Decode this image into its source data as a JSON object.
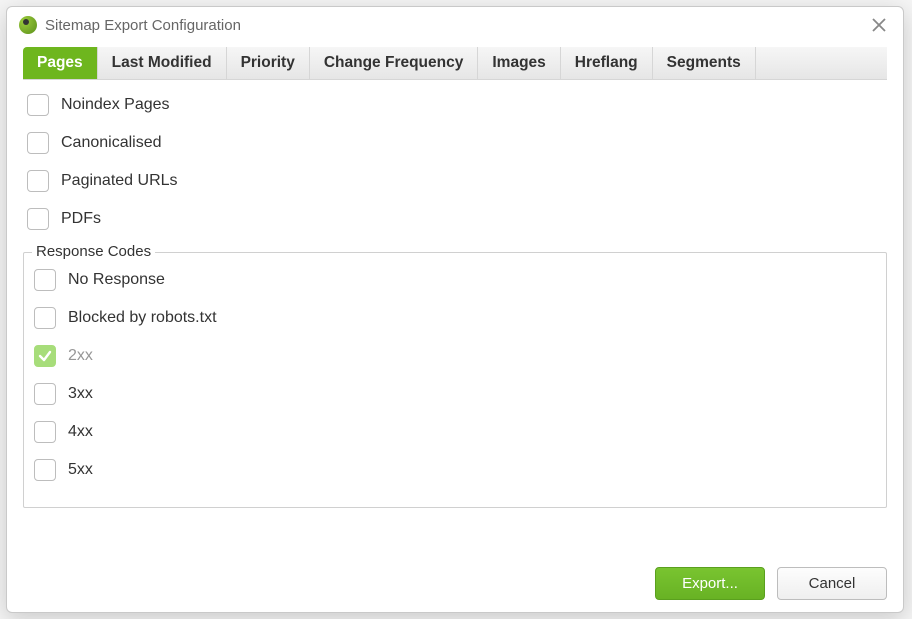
{
  "dialog": {
    "title": "Sitemap Export Configuration"
  },
  "tabs": [
    {
      "label": "Pages",
      "active": true
    },
    {
      "label": "Last Modified",
      "active": false
    },
    {
      "label": "Priority",
      "active": false
    },
    {
      "label": "Change Frequency",
      "active": false
    },
    {
      "label": "Images",
      "active": false
    },
    {
      "label": "Hreflang",
      "active": false
    },
    {
      "label": "Segments",
      "active": false
    }
  ],
  "page_options": [
    {
      "label": "Noindex Pages",
      "checked": false
    },
    {
      "label": "Canonicalised",
      "checked": false
    },
    {
      "label": "Paginated URLs",
      "checked": false
    },
    {
      "label": "PDFs",
      "checked": false
    }
  ],
  "response_codes": {
    "legend": "Response Codes",
    "items": [
      {
        "label": "No Response",
        "checked": false,
        "disabled": false
      },
      {
        "label": "Blocked by robots.txt",
        "checked": false,
        "disabled": false
      },
      {
        "label": "2xx",
        "checked": true,
        "disabled": true
      },
      {
        "label": "3xx",
        "checked": false,
        "disabled": false
      },
      {
        "label": "4xx",
        "checked": false,
        "disabled": false
      },
      {
        "label": "5xx",
        "checked": false,
        "disabled": false
      }
    ]
  },
  "buttons": {
    "export": "Export...",
    "cancel": "Cancel"
  }
}
